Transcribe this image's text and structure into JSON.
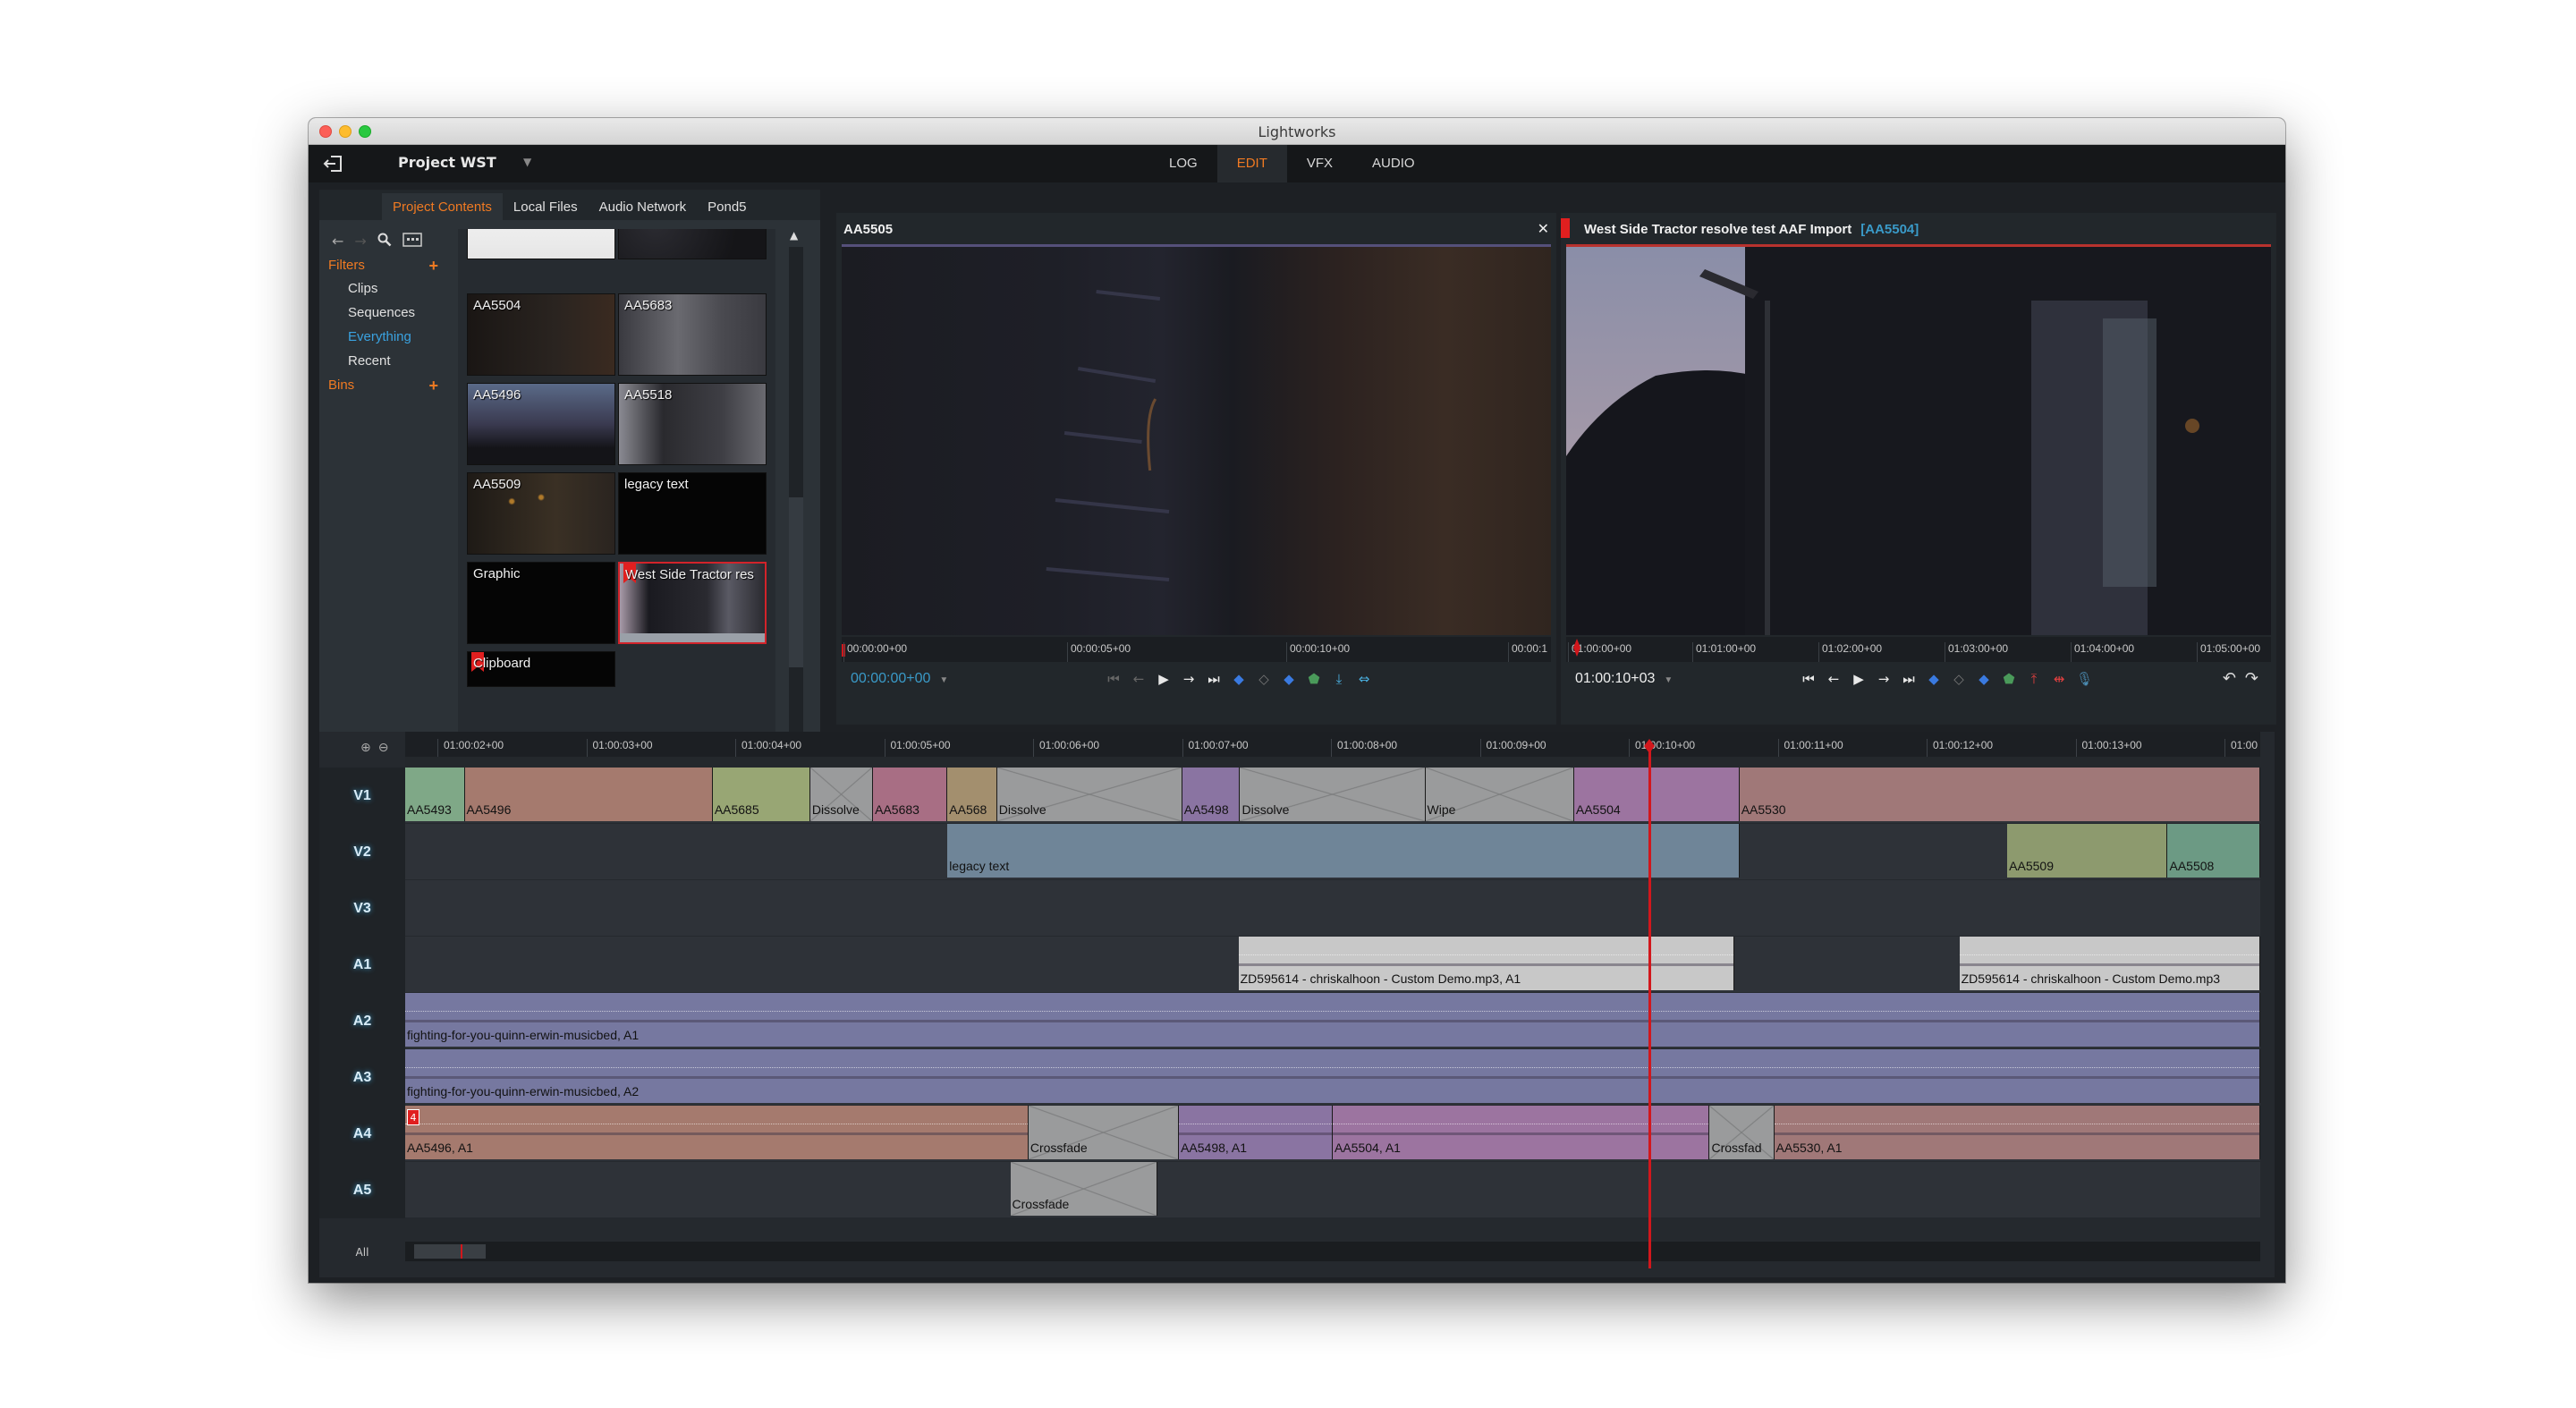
{
  "window": {
    "title": "Lightworks"
  },
  "topbar": {
    "project_name": "Project WST",
    "modes": [
      {
        "label": "LOG",
        "active": false
      },
      {
        "label": "EDIT",
        "active": true
      },
      {
        "label": "VFX",
        "active": false
      },
      {
        "label": "AUDIO",
        "active": false
      }
    ]
  },
  "project_panel": {
    "tabs": [
      {
        "label": "Project Contents",
        "active": true
      },
      {
        "label": "Local Files",
        "active": false
      },
      {
        "label": "Audio Network",
        "active": false
      },
      {
        "label": "Pond5",
        "active": false
      }
    ],
    "filters_label": "Filters",
    "filters": [
      {
        "label": "Clips",
        "active": false
      },
      {
        "label": "Sequences",
        "active": false
      },
      {
        "label": "Everything",
        "active": true
      },
      {
        "label": "Recent",
        "active": false
      }
    ],
    "bins_label": "Bins",
    "thumbnails": [
      {
        "label": "",
        "kind": "document"
      },
      {
        "label": "",
        "kind": "night-light"
      },
      {
        "label": "AA5504",
        "kind": "dark"
      },
      {
        "label": "AA5683",
        "kind": "room"
      },
      {
        "label": "AA5496",
        "kind": "dusk"
      },
      {
        "label": "AA5518",
        "kind": "silhouette"
      },
      {
        "label": "AA5509",
        "kind": "dark-lights"
      },
      {
        "label": "legacy text",
        "kind": "black"
      },
      {
        "label": "Graphic",
        "kind": "black"
      },
      {
        "label": "West Side Tractor res",
        "kind": "sequence",
        "selected": true,
        "flagged": true
      },
      {
        "label": "Clipboard",
        "kind": "black",
        "flagged": true
      }
    ]
  },
  "source_viewer": {
    "title": "AA5505",
    "timecode": "00:00:00+00",
    "ruler": [
      "00:00:00+00",
      "00:00:05+00",
      "00:00:10+00",
      "00:00:1"
    ]
  },
  "record_viewer": {
    "title": "West Side Tractor resolve test AAF Import",
    "subtitle": "[AA5504]",
    "timecode": "01:00:10+03",
    "ruler": [
      "01:00:00+00",
      "01:01:00+00",
      "01:02:00+00",
      "01:03:00+00",
      "01:04:00+00",
      "01:05:00+00"
    ]
  },
  "timeline": {
    "ruler": [
      "01:00:02+00",
      "01:00:03+00",
      "01:00:04+00",
      "01:00:05+00",
      "01:00:06+00",
      "01:00:07+00",
      "01:00:08+00",
      "01:00:09+00",
      "01:00:10+00",
      "01:00:11+00",
      "01:00:12+00",
      "01:00:13+00",
      "01:00"
    ],
    "all_label": "All",
    "tracks": [
      {
        "name": "V1",
        "clips": [
          {
            "label": "AA5493",
            "color": "#7fa887",
            "start": 0,
            "end": 36
          },
          {
            "label": "AA5496",
            "color": "#a57a6e",
            "start": 36,
            "end": 186
          },
          {
            "label": "AA5685",
            "color": "#98a674",
            "start": 186,
            "end": 245
          },
          {
            "label": "Dissolve",
            "fx": true,
            "start": 245,
            "end": 283
          },
          {
            "label": "AA5683",
            "color": "#a86e84",
            "start": 283,
            "end": 328
          },
          {
            "label": "AA568",
            "color": "#a38f6e",
            "start": 328,
            "end": 358
          },
          {
            "label": "Dissolve",
            "fx": true,
            "start": 358,
            "end": 470
          },
          {
            "label": "AA5498",
            "color": "#8a74a2",
            "start": 470,
            "end": 505
          },
          {
            "label": "Dissolve",
            "fx": true,
            "start": 505,
            "end": 617
          },
          {
            "label": "Wipe",
            "fx": true,
            "start": 617,
            "end": 707
          },
          {
            "label": "AA5504",
            "color": "#9c74a0",
            "start": 707,
            "end": 807
          },
          {
            "label": "AA5530",
            "color": "#a07878",
            "start": 807,
            "end": 1122
          }
        ]
      },
      {
        "name": "V2",
        "clips": [
          {
            "label": "legacy text",
            "color": "#6f8598",
            "start": 328,
            "end": 807
          },
          {
            "label": "AA5509",
            "color": "#8d9a6e",
            "start": 969,
            "end": 1066
          },
          {
            "label": "AA5508",
            "color": "#6c9a84",
            "start": 1066,
            "end": 1122
          }
        ]
      },
      {
        "name": "V3",
        "clips": []
      },
      {
        "name": "A1",
        "clips": [
          {
            "label": "ZD595614 - chriskalhoon - Custom Demo.mp3, A1",
            "color": "#c8c8c8",
            "start": 504,
            "end": 804
          },
          {
            "label": "ZD595614 - chriskalhoon - Custom Demo.mp3",
            "color": "#c8c8c8",
            "start": 940,
            "end": 1122
          }
        ]
      },
      {
        "name": "A2",
        "clips": [
          {
            "label": "fighting-for-you-quinn-erwin-musicbed, A1",
            "color": "#7678a0",
            "start": 0,
            "end": 1122
          }
        ]
      },
      {
        "name": "A3",
        "clips": [
          {
            "label": "fighting-for-you-quinn-erwin-musicbed, A2",
            "color": "#7678a0",
            "start": 0,
            "end": 1122
          }
        ]
      },
      {
        "name": "A4",
        "clips": [
          {
            "label": "AA5496, A1",
            "color": "#a57a6e",
            "start": 0,
            "end": 377,
            "marker": "4"
          },
          {
            "label": "Crossfade",
            "fx": true,
            "start": 377,
            "end": 468
          },
          {
            "label": "AA5498, A1",
            "color": "#8a74a2",
            "start": 468,
            "end": 561
          },
          {
            "label": "AA5504, A1",
            "color": "#9c74a0",
            "start": 561,
            "end": 789
          },
          {
            "label": "Crossfad",
            "fx": true,
            "start": 789,
            "end": 828
          },
          {
            "label": "AA5530, A1",
            "color": "#a07878",
            "start": 828,
            "end": 1122
          }
        ]
      },
      {
        "name": "A5",
        "clips": [
          {
            "label": "Crossfade",
            "fx": true,
            "start": 366,
            "end": 455
          }
        ]
      }
    ]
  }
}
